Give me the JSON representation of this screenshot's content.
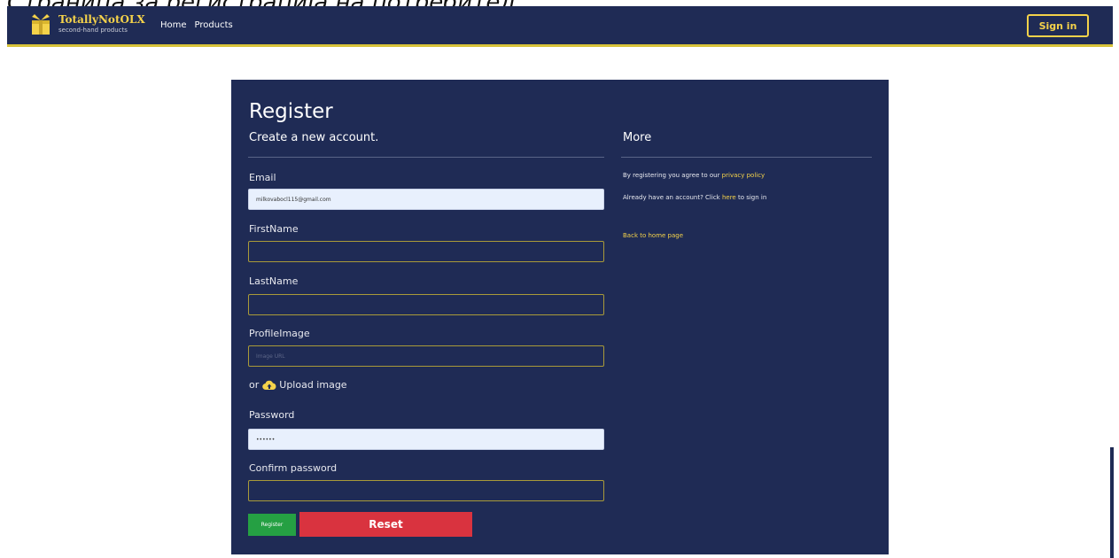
{
  "caption": "Страница за регистрација на потребител",
  "navbar": {
    "brand_name": "TotallyNotOLX",
    "brand_tagline": "second-hand products",
    "links": [
      "Home",
      "Products"
    ],
    "signin_label": "Sign in"
  },
  "form": {
    "title": "Register",
    "subtitle": "Create a new account.",
    "email_label": "Email",
    "email_value": "milkovabocl115@gmail.com",
    "firstname_label": "FirstName",
    "lastname_label": "LastName",
    "profileimage_label": "ProfileImage",
    "profileimage_placeholder": "Image URL",
    "upload_or": "or",
    "upload_label": "Upload image",
    "password_label": "Password",
    "password_value": "••••••",
    "confirm_label": "Confirm password",
    "register_label": "Register",
    "reset_label": "Reset"
  },
  "more": {
    "title": "More",
    "privacy_prefix": "By registering you agree to our ",
    "privacy_link": "privacy policy",
    "account_prefix": "Already have an account? Click ",
    "account_link": "here",
    "account_suffix": " to sign in",
    "back_link": "Back to home page"
  },
  "colors": {
    "navy": "#1f2b55",
    "gold": "#f4d24a",
    "green": "#25a043",
    "red": "#d9333f"
  }
}
